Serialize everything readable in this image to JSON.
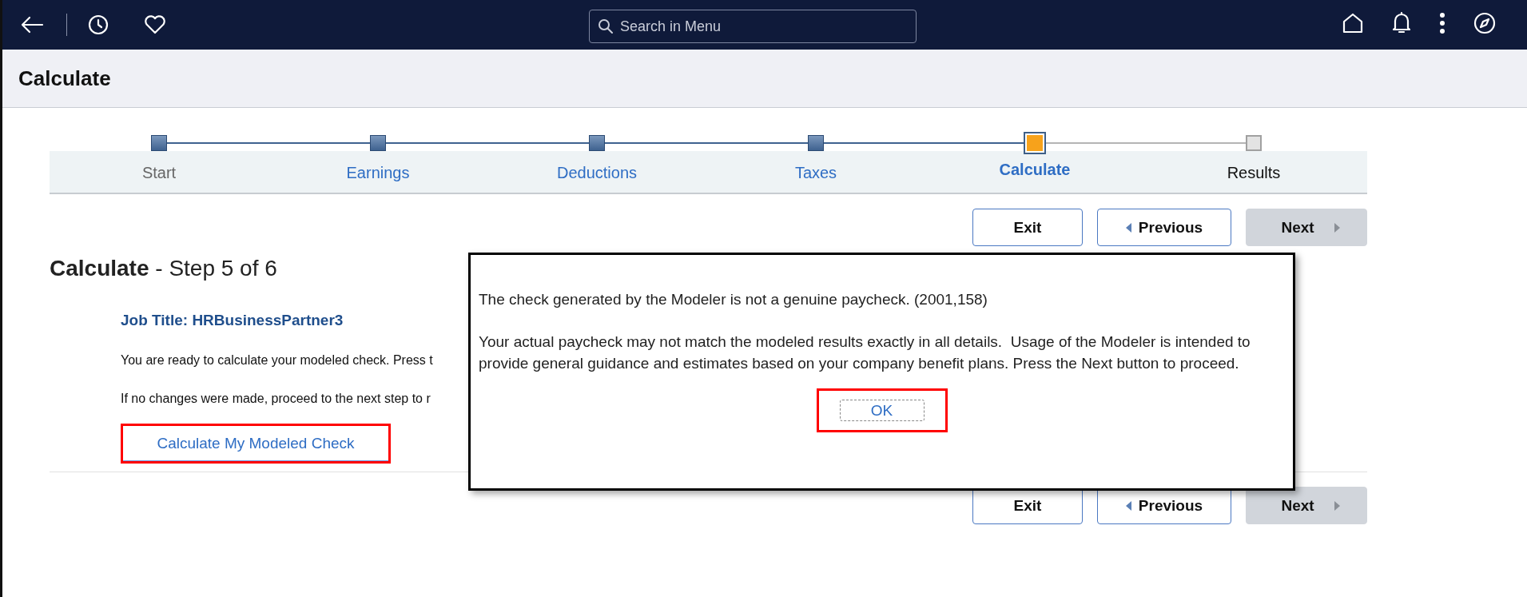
{
  "top_bar": {
    "search": {
      "placeholder": "Search in Menu"
    }
  },
  "page_title": "Calculate",
  "steps": [
    {
      "label": "Start",
      "selected": false,
      "complete": true,
      "disabled": true
    },
    {
      "label": "Earnings",
      "selected": false,
      "complete": true,
      "disabled": false
    },
    {
      "label": "Deductions",
      "selected": false,
      "complete": true,
      "disabled": false
    },
    {
      "label": "Taxes",
      "selected": false,
      "complete": true,
      "disabled": false
    },
    {
      "label": "Calculate",
      "selected": true,
      "complete": false,
      "disabled": false
    },
    {
      "label": "Results",
      "selected": false,
      "complete": false,
      "disabled": false
    }
  ],
  "nav_buttons_top": [
    {
      "kind": "exit",
      "label": "Exit",
      "disabled": false
    },
    {
      "kind": "previous",
      "label": "Previous",
      "disabled": false
    },
    {
      "kind": "next",
      "label": "Next",
      "disabled": true
    }
  ],
  "heading": {
    "title": "Calculate",
    "subtitle": "- Step 5 of 6"
  },
  "job_title": "Job Title: HRBusinessPartner3",
  "instructions": [
    "You are ready to calculate your modeled check. Press t",
    "If no changes were made, proceed to the next step to r"
  ],
  "calculate_button": {
    "label": "Calculate My Modeled Check",
    "highlighted": true
  },
  "nav_buttons_bottom": [
    {
      "kind": "exit",
      "label": "Exit",
      "disabled": false
    },
    {
      "kind": "previous",
      "label": "Previous",
      "disabled": false
    },
    {
      "kind": "next",
      "label": "Next",
      "disabled": true
    }
  ],
  "dialog": {
    "message": "The check generated by the Modeler is not a genuine paycheck. (2001,158)",
    "detail": "Your actual paycheck may not match the modeled results exactly in all details.  Usage of the Modeler is intended to provide general guidance and estimates based on your company benefit plans. Press the Next button to proceed.",
    "ok_button": {
      "label": "OK",
      "highlighted": true
    }
  }
}
